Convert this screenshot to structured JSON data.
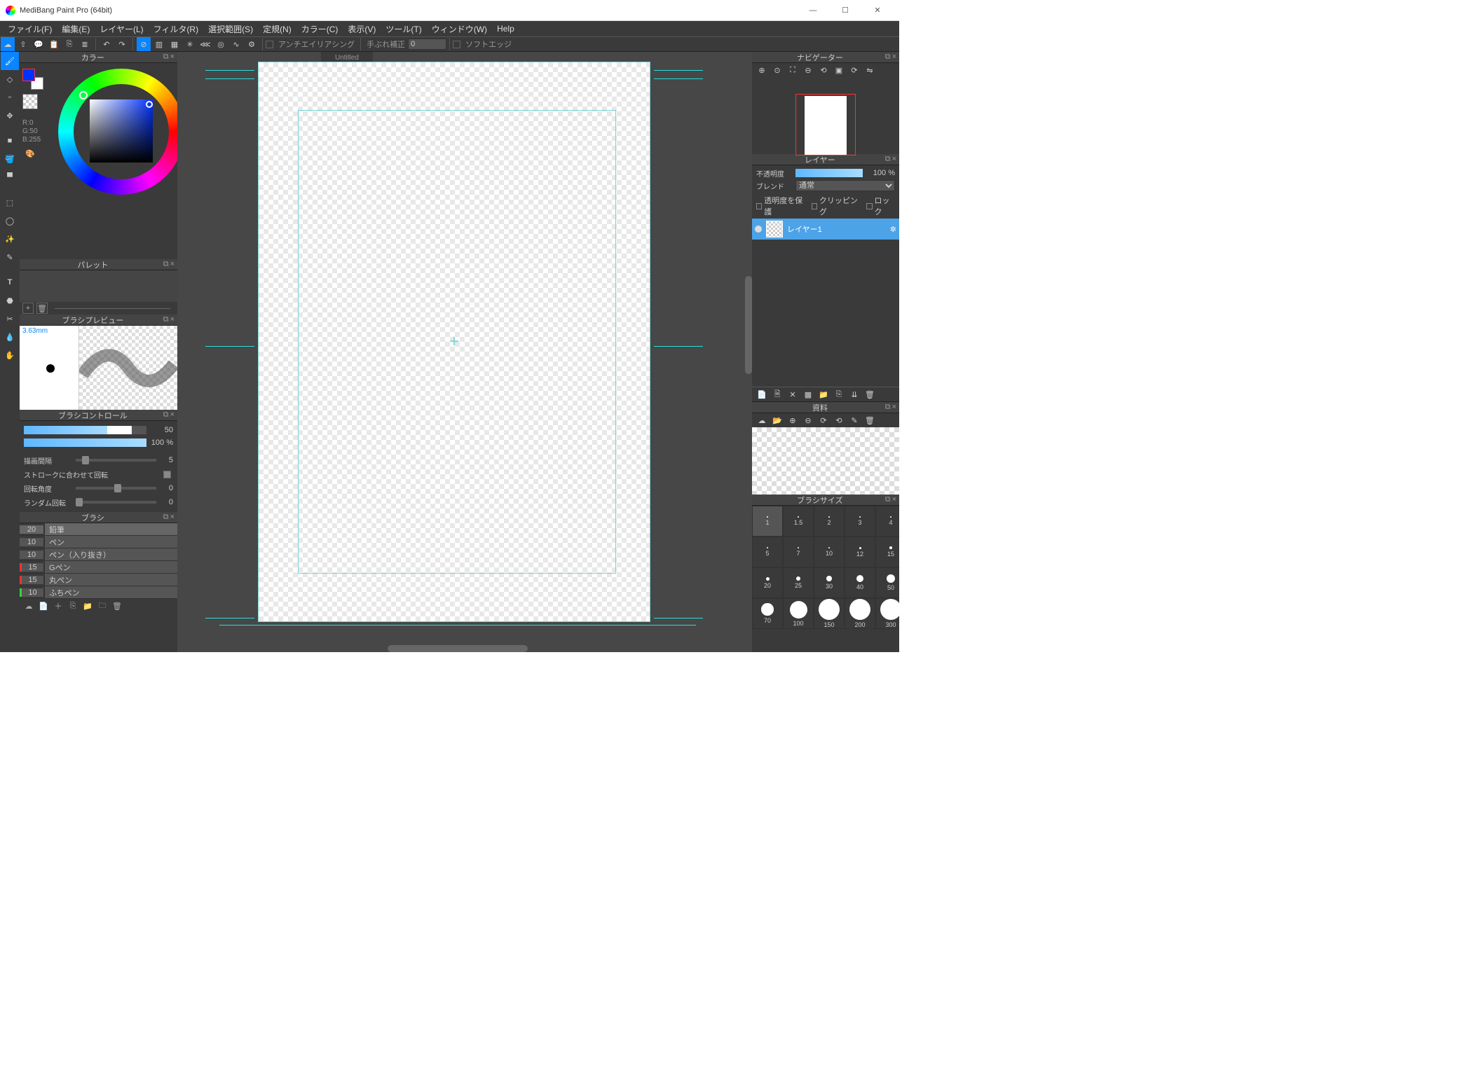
{
  "app": {
    "title": "MediBang Paint Pro (64bit)"
  },
  "menu": [
    "ファイル(F)",
    "編集(E)",
    "レイヤー(L)",
    "フィルタ(R)",
    "選択範囲(S)",
    "定規(N)",
    "カラー(C)",
    "表示(V)",
    "ツール(T)",
    "ウィンドウ(W)",
    "Help"
  ],
  "topbar": {
    "antialias_label": "アンチエイリアシング",
    "shake_label": "手ぶれ補正",
    "shake_value": "0",
    "softedge_label": "ソフトエッジ"
  },
  "canvas": {
    "tab_title": "Untitled"
  },
  "panels": {
    "color": {
      "title": "カラー",
      "rgb": "R:0\nG:50\nB:255"
    },
    "palette": {
      "title": "パレット"
    },
    "preview": {
      "title": "ブラシプレビュー",
      "mm": "3.63mm"
    },
    "brush_control": {
      "title": "ブラシコントロール",
      "size_value": "50",
      "opacity_value": "100 %",
      "interval_label": "描画間隔",
      "interval_value": "5",
      "stroke_label": "ストロークに合わせて回転",
      "angle_label": "回転角度",
      "angle_value": "0",
      "random_label": "ランダム回転",
      "random_value": "0"
    },
    "brush": {
      "title": "ブラシ",
      "items": [
        {
          "size": "20",
          "name": "鉛筆",
          "color": ""
        },
        {
          "size": "10",
          "name": "ペン",
          "color": ""
        },
        {
          "size": "10",
          "name": "ペン（入り抜き）",
          "color": ""
        },
        {
          "size": "15",
          "name": "Gペン",
          "color": "r"
        },
        {
          "size": "15",
          "name": "丸ペン",
          "color": "r"
        },
        {
          "size": "10",
          "name": "ふちペン",
          "color": "g"
        }
      ]
    },
    "navigator": {
      "title": "ナビゲーター"
    },
    "layer": {
      "title": "レイヤー",
      "opacity_label": "不透明度",
      "opacity_value": "100 %",
      "blend_label": "ブレンド",
      "blend_value": "通常",
      "protect_label": "透明度を保護",
      "clip_label": "クリッピング",
      "lock_label": "ロック",
      "layer_name": "レイヤー1"
    },
    "material": {
      "title": "資料"
    },
    "brush_size": {
      "title": "ブラシサイズ",
      "sizes": [
        1,
        1.5,
        2,
        3,
        4,
        5,
        7,
        10,
        12,
        15,
        20,
        25,
        30,
        40,
        50,
        70,
        100,
        150,
        200,
        300
      ]
    }
  }
}
